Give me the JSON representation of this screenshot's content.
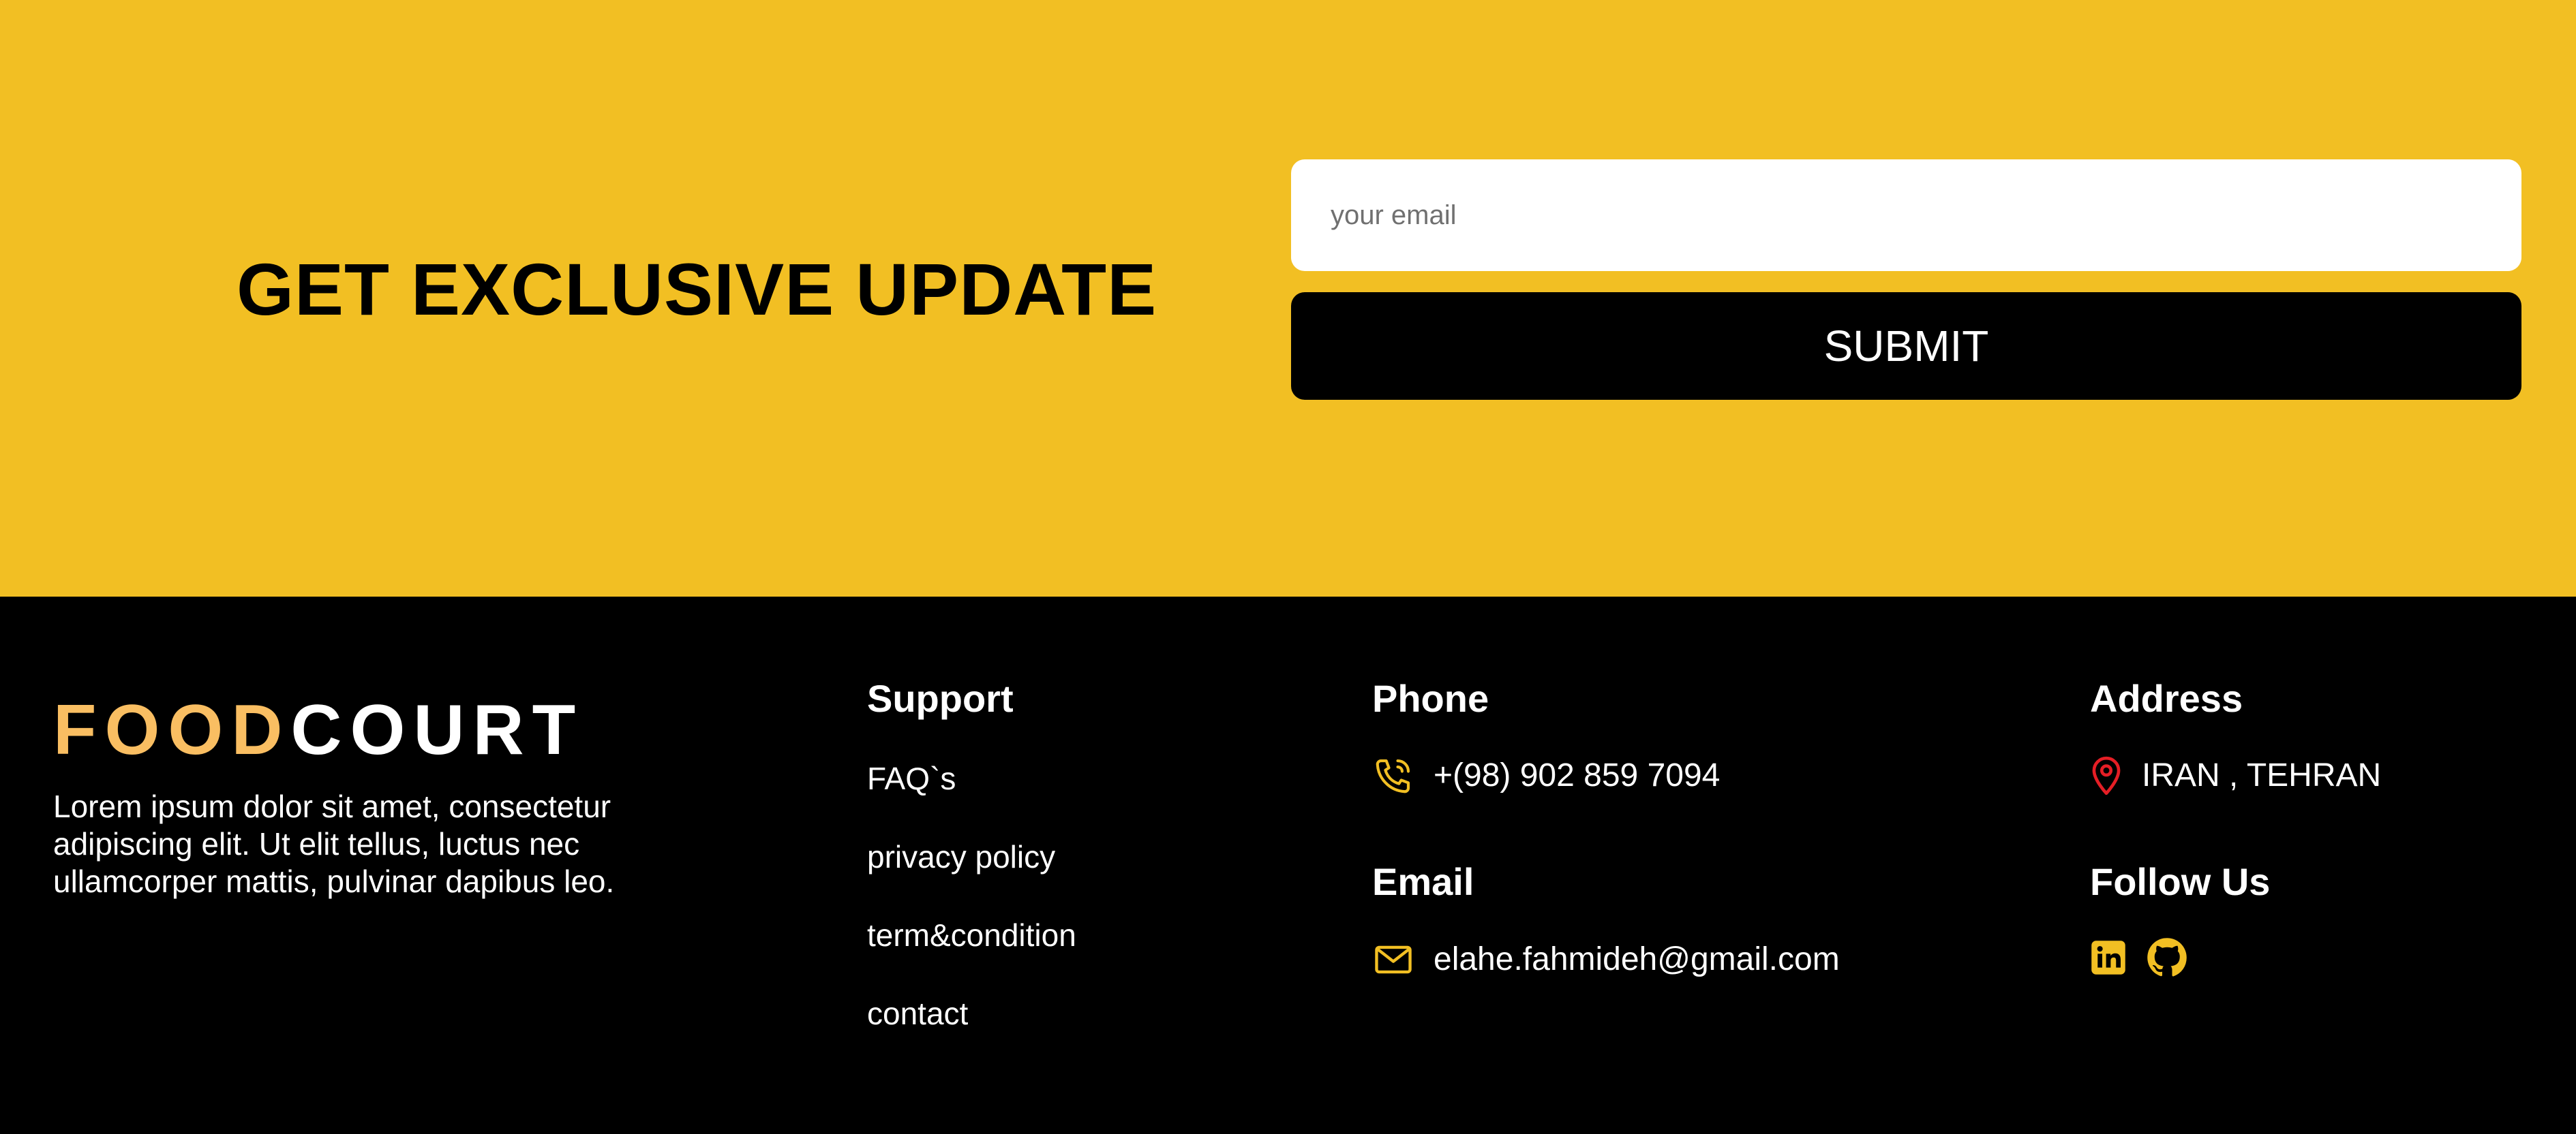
{
  "subscribe": {
    "title": "GET EXCLUSIVE UPDATE",
    "email_placeholder": "your email",
    "submit_label": "SUBMIT",
    "background_color": "#f2bf23"
  },
  "footer": {
    "logo": {
      "part1": "FOOD",
      "part2": "COURT",
      "part1_color": "#f9be62"
    },
    "about": "Lorem ipsum dolor sit amet, consectetur adipiscing elit. Ut elit tellus, luctus nec ullamcorper mattis, pulvinar dapibus leo.",
    "support": {
      "title": "Support",
      "links": [
        "FAQ`s",
        "privacy policy",
        "term&condition",
        "contact"
      ]
    },
    "phone": {
      "title": "Phone",
      "value": "+(98) 902 859 7094",
      "icon": "phone-icon"
    },
    "email": {
      "title": "Email",
      "value": "elahe.fahmideh@gmail.com",
      "icon": "envelope-icon"
    },
    "address": {
      "title": "Address",
      "value": "IRAN , TEHRAN",
      "icon": "map-pin-icon"
    },
    "follow": {
      "title": "Follow Us",
      "icons": [
        "linkedin-icon",
        "github-icon"
      ]
    },
    "accent_color": "#f2bf23",
    "pin_color": "#e51e25"
  }
}
